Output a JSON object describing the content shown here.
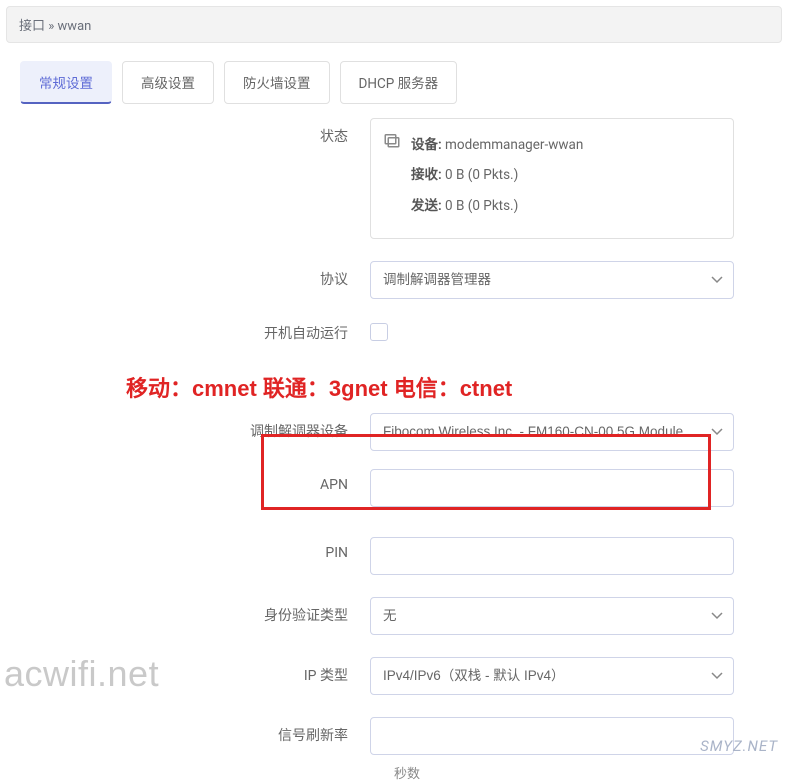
{
  "breadcrumb": "接口 » wwan",
  "tabs": [
    {
      "label": "常规设置",
      "active": true
    },
    {
      "label": "高级设置",
      "active": false
    },
    {
      "label": "防火墙设置",
      "active": false
    },
    {
      "label": "DHCP 服务器",
      "active": false
    }
  ],
  "fields": {
    "status": {
      "label": "状态",
      "device_label": "设备:",
      "device_value": "modemmanager-wwan",
      "rx_label": "接收:",
      "rx_value": "0 B (0 Pkts.)",
      "tx_label": "发送:",
      "tx_value": "0 B (0 Pkts.)"
    },
    "protocol": {
      "label": "协议",
      "value": "调制解调器管理器"
    },
    "autostart": {
      "label": "开机自动运行",
      "checked": false
    },
    "modem_device": {
      "label": "调制解调器设备",
      "value": "Fibocom Wireless Inc. - FM160-CN-00 5G Module"
    },
    "apn": {
      "label": "APN",
      "value": ""
    },
    "pin": {
      "label": "PIN",
      "value": ""
    },
    "auth_type": {
      "label": "身份验证类型",
      "value": "无"
    },
    "ip_type": {
      "label": "IP 类型",
      "value": "IPv4/IPv6（双栈 - 默认 IPv4）"
    },
    "signal_rate": {
      "label": "信号刷新率",
      "value": "",
      "help": "秒数"
    }
  },
  "annotation": "移动：cmnet 联通：3gnet 电信：ctnet",
  "watermarks": {
    "left": "acwifi.net",
    "right": "SMYZ.NET"
  }
}
